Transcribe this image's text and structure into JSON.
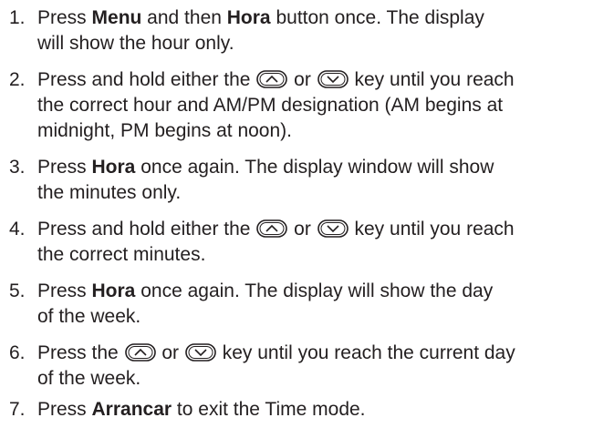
{
  "steps": [
    {
      "number": "1.",
      "l1a": "Press ",
      "l1b": "Menu",
      "l1c": " and then ",
      "l1d": "Hora",
      "l1e": " button once. The display",
      "l2": "will show the hour only."
    },
    {
      "number": "2.",
      "l1a": "Press and hold either the ",
      "l1b": " or ",
      "l1c": " key until you reach",
      "l2": "the correct hour and AM/PM designation (AM begins at",
      "l3": "midnight, PM begins at noon)."
    },
    {
      "number": "3.",
      "l1a": "Press ",
      "l1b": "Hora",
      "l1c": " once again. The display window will show",
      "l2": "the minutes only."
    },
    {
      "number": "4.",
      "l1a": "Press and hold either the ",
      "l1b": " or ",
      "l1c": " key until you reach",
      "l2": "the correct minutes."
    },
    {
      "number": "5.",
      "l1a": "Press ",
      "l1b": "Hora",
      "l1c": " once again. The display will show the day",
      "l2": "of the week."
    },
    {
      "number": "6.",
      "l1a": "Press the ",
      "l1b": " or ",
      "l1c": " key until you reach the current day",
      "l2": "of the week."
    },
    {
      "number": "7.",
      "l1a": "Press ",
      "l1b": "Arrancar",
      "l1c": " to exit the Time mode."
    }
  ],
  "icons": {
    "up": "up-arrow-key-icon",
    "down": "down-arrow-key-icon"
  },
  "colors": {
    "text": "#231f20",
    "background": "#ffffff"
  }
}
